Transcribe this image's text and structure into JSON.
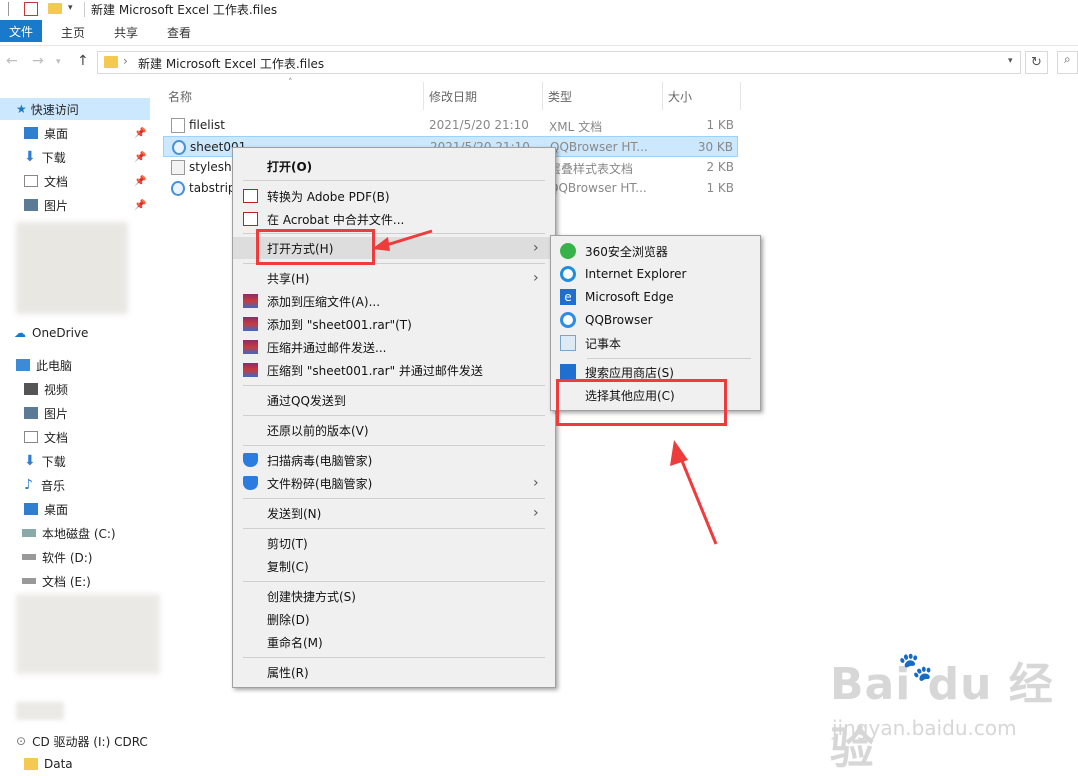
{
  "window": {
    "title": "新建 Microsoft Excel 工作表.files"
  },
  "ribbon": {
    "tabs": [
      "文件",
      "主页",
      "共享",
      "查看"
    ]
  },
  "address": {
    "path": "新建 Microsoft Excel 工作表.files",
    "separator": "›",
    "refresh_icon": "refresh-icon",
    "search_icon": "search-icon"
  },
  "sidebar": {
    "quick_access": "快速访问",
    "pinned": [
      "桌面",
      "下载",
      "文档",
      "图片"
    ],
    "onedrive": "OneDrive",
    "this_pc": "此电脑",
    "pc_items": [
      "视频",
      "图片",
      "文档",
      "下载",
      "音乐",
      "桌面",
      "本地磁盘 (C:)",
      "软件 (D:)",
      "文档 (E:)"
    ],
    "cd_drive": "CD 驱动器 (I:) CDRC",
    "data": "Data"
  },
  "columns": {
    "name": "名称",
    "date": "修改日期",
    "type": "类型",
    "size": "大小"
  },
  "files": [
    {
      "name": "filelist",
      "date": "2021/5/20 21:10",
      "type": "XML 文档",
      "size": "1 KB"
    },
    {
      "name": "sheet001",
      "date": "2021/5/20 21:10",
      "type": "QQBrowser HT...",
      "size": "30 KB"
    },
    {
      "name": "styleshe",
      "date": "",
      "type": "层叠样式表文档",
      "size": "2 KB"
    },
    {
      "name": "tabstrip",
      "date": "",
      "type": "QQBrowser HT...",
      "size": "1 KB"
    }
  ],
  "context_menu": {
    "open": "打开(O)",
    "to_pdf": "转换为 Adobe PDF(B)",
    "acrobat_merge": "在 Acrobat 中合并文件...",
    "open_with": "打开方式(H)",
    "share": "共享(H)",
    "add_archive": "添加到压缩文件(A)...",
    "add_rar": "添加到 \"sheet001.rar\"(T)",
    "compress_email": "压缩并通过邮件发送...",
    "compress_rar_email": "压缩到 \"sheet001.rar\" 并通过邮件发送",
    "send_qq": "通过QQ发送到",
    "restore": "还原以前的版本(V)",
    "scan_virus": "扫描病毒(电脑管家)",
    "shred": "文件粉碎(电脑管家)",
    "send_to": "发送到(N)",
    "cut": "剪切(T)",
    "copy": "复制(C)",
    "create_shortcut": "创建快捷方式(S)",
    "delete": "删除(D)",
    "rename": "重命名(M)",
    "properties": "属性(R)"
  },
  "open_with_menu": {
    "apps": [
      "360安全浏览器",
      "Internet Explorer",
      "Microsoft Edge",
      "QQBrowser",
      "记事本"
    ],
    "store": "搜索应用商店(S)",
    "choose_other": "选择其他应用(C)"
  },
  "watermark": {
    "brand": "Bai  du 经验",
    "url": "jingyan.baidu.com"
  },
  "colors": {
    "accent": "#1979ca",
    "selection": "#cce8ff",
    "annotation": "#ee3b3b"
  }
}
